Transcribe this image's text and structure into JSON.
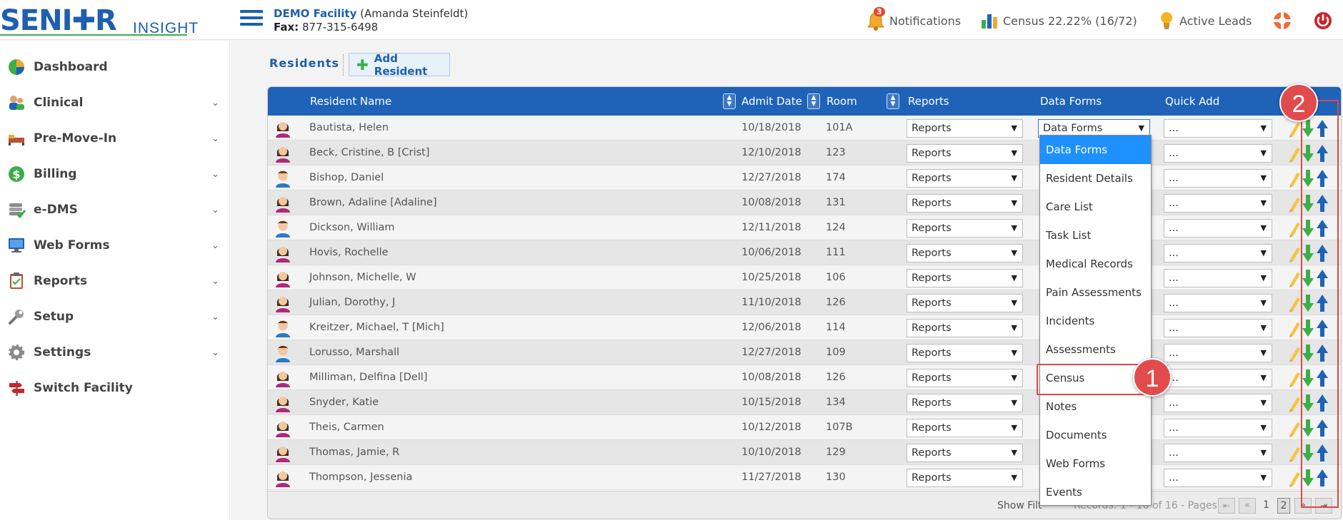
{
  "header": {
    "logo_main": "SENI✚R",
    "logo_sub": "INSIGHT",
    "facility_name": "DEMO Facility",
    "facility_user": "(Amanda Steinfeldt)",
    "fax_label": "Fax:",
    "fax_number": "877-315-6498",
    "notifications_label": "Notifications",
    "notifications_count": "3",
    "census_label": "Census 22.22% (16/72)",
    "active_leads_label": "Active Leads"
  },
  "sidebar": {
    "items": [
      {
        "label": "Dashboard",
        "icon": "dashboard-pie-icon"
      },
      {
        "label": "Clinical",
        "icon": "clinical-users-icon"
      },
      {
        "label": "Pre-Move-In",
        "icon": "bed-icon"
      },
      {
        "label": "Billing",
        "icon": "dollar-icon"
      },
      {
        "label": "e-DMS",
        "icon": "database-check-icon"
      },
      {
        "label": "Web Forms",
        "icon": "monitor-icon"
      },
      {
        "label": "Reports",
        "icon": "clipboard-icon"
      },
      {
        "label": "Setup",
        "icon": "wrench-icon"
      },
      {
        "label": "Settings",
        "icon": "gear-icon"
      },
      {
        "label": "Switch Facility",
        "icon": "signpost-icon"
      }
    ]
  },
  "page": {
    "title": "Residents",
    "add_button": "Add Resident"
  },
  "table": {
    "headers": {
      "name": "Resident Name",
      "admit": "Admit Date",
      "room": "Room",
      "reports": "Reports",
      "forms": "Data Forms",
      "quick": "Quick Add"
    },
    "reports_value": "Reports",
    "forms_value": "Data Forms",
    "quick_value": "...",
    "rows": [
      {
        "name": "Bautista, Helen",
        "admit": "10/18/2018",
        "room": "101A",
        "gender": "f"
      },
      {
        "name": "Beck, Cristine, B [Crist]",
        "admit": "12/10/2018",
        "room": "123",
        "gender": "f"
      },
      {
        "name": "Bishop, Daniel",
        "admit": "12/27/2018",
        "room": "174",
        "gender": "m"
      },
      {
        "name": "Brown, Adaline [Adaline]",
        "admit": "10/08/2018",
        "room": "131",
        "gender": "f"
      },
      {
        "name": "Dickson, William",
        "admit": "12/11/2018",
        "room": "124",
        "gender": "m"
      },
      {
        "name": "Hovis, Rochelle",
        "admit": "10/06/2018",
        "room": "111",
        "gender": "f"
      },
      {
        "name": "Johnson, Michelle, W",
        "admit": "10/25/2018",
        "room": "106",
        "gender": "f"
      },
      {
        "name": "Julian, Dorothy, J",
        "admit": "11/10/2018",
        "room": "126",
        "gender": "f"
      },
      {
        "name": "Kreitzer, Michael, T [Mich]",
        "admit": "12/06/2018",
        "room": "114",
        "gender": "m"
      },
      {
        "name": "Lorusso, Marshall",
        "admit": "12/27/2018",
        "room": "109",
        "gender": "m"
      },
      {
        "name": "Milliman, Delfina [Dell]",
        "admit": "10/08/2018",
        "room": "126",
        "gender": "f"
      },
      {
        "name": "Snyder, Katie",
        "admit": "10/15/2018",
        "room": "134",
        "gender": "f"
      },
      {
        "name": "Theis, Carmen",
        "admit": "10/12/2018",
        "room": "107B",
        "gender": "f"
      },
      {
        "name": "Thomas, Jamie, R",
        "admit": "10/10/2018",
        "room": "129",
        "gender": "f"
      },
      {
        "name": "Thompson, Jessenia",
        "admit": "11/27/2018",
        "room": "130",
        "gender": "f"
      }
    ]
  },
  "dropdown": {
    "options": [
      "Data Forms",
      "Resident Details",
      "Care List",
      "Task List",
      "Medical Records",
      "Pain Assessments",
      "Incidents",
      "Assessments",
      "Census",
      "Notes",
      "Documents",
      "Web Forms",
      "Events"
    ]
  },
  "pager": {
    "show_filter": "Show Filt",
    "records": "Records: 1 - 16 of 16 - Pages:",
    "page1": "1",
    "page2": "2"
  },
  "callouts": [
    "1",
    "2"
  ],
  "colors": {
    "brand_blue": "#1e5fae",
    "header_blue": "#1e63b8",
    "accent_green": "#3cae49",
    "highlight_red": "#e04848",
    "selected_option": "#1e90ff"
  }
}
